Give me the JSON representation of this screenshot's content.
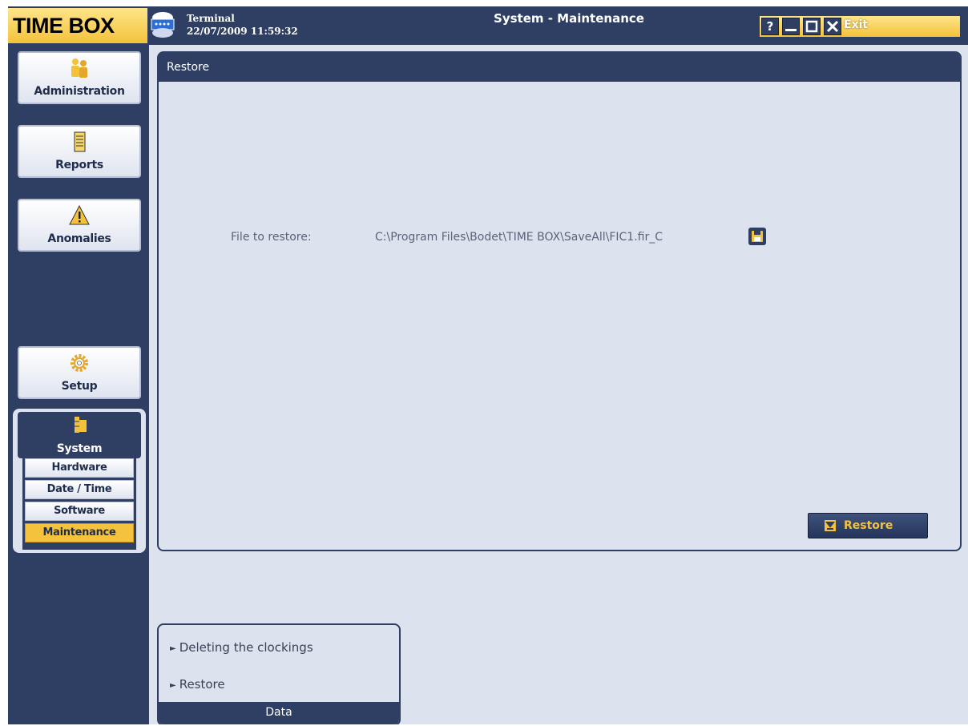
{
  "app": {
    "logo_text": "TIME BOX",
    "terminal_label": "Terminal",
    "datetime": "22/07/2009 11:59:32",
    "window_title": "System - Maintenance",
    "exit_label": "Exit"
  },
  "sidebar": {
    "items": [
      {
        "label": "Administration",
        "icon": "users-icon"
      },
      {
        "label": "Reports",
        "icon": "report-icon"
      },
      {
        "label": "Anomalies",
        "icon": "warning-icon"
      },
      {
        "label": "Setup",
        "icon": "gear-icon"
      }
    ],
    "system": {
      "label": "System",
      "icon": "folder-tree-icon",
      "subitems": [
        {
          "label": "Hardware",
          "active": false
        },
        {
          "label": "Date / Time",
          "active": false
        },
        {
          "label": "Software",
          "active": false
        },
        {
          "label": "Maintenance",
          "active": true
        }
      ]
    }
  },
  "restore_panel": {
    "title": "Restore",
    "file_label": "File to restore:",
    "file_path": "C:\\Program Files\\Bodet\\TIME BOX\\SaveAll\\FIC1.fir_C",
    "restore_button": "Restore"
  },
  "data_panel": {
    "links": [
      "Deleting the clockings",
      "Restore"
    ],
    "footer": "Data"
  },
  "colors": {
    "navy": "#2e3f63",
    "accent_yellow": "#f5c23d",
    "panel_bg": "#dde2ef"
  }
}
